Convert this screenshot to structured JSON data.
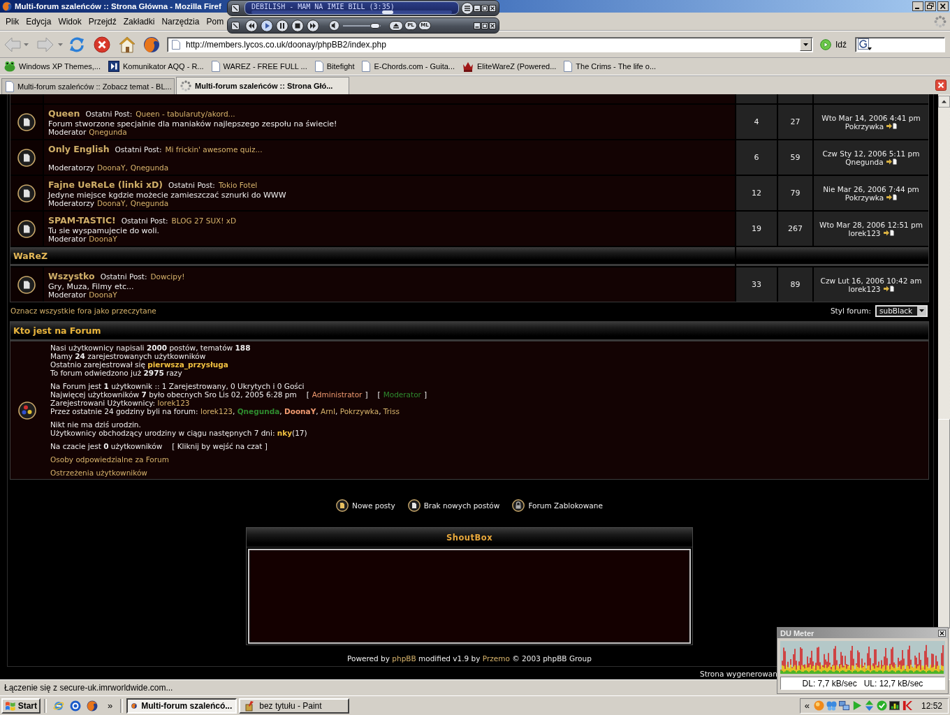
{
  "window": {
    "title": "Multi-forum szaleńców :: Strona Główna - Mozilla Firef"
  },
  "winamp": {
    "song": "DEBILISH - MAM NA IMIE BILL (3:35)",
    "seek": {
      "level": 0.68
    },
    "volume": {
      "level": 0.85
    },
    "buttons": [
      "PL",
      "ML"
    ]
  },
  "menu": [
    "Plik",
    "Edycja",
    "Widok",
    "Przejdź",
    "Zakładki",
    "Narzędzia",
    "Pom"
  ],
  "toolbar": {
    "back": {
      "disabled": true
    },
    "forward": {
      "disabled": true
    },
    "address": "http://members.lycos.co.uk/doonay/phpBB2/index.php",
    "go": "Idź"
  },
  "bookmarks": [
    {
      "label": "Windows XP Themes,...",
      "kind": "frog"
    },
    {
      "label": "Komunikator AQQ - R...",
      "kind": "player"
    },
    {
      "label": "WAREZ - FREE FULL ...",
      "kind": "page"
    },
    {
      "label": "Bitefight",
      "kind": "page"
    },
    {
      "label": "E-Chords.com - Guita...",
      "kind": "page"
    },
    {
      "label": "EliteWareZ (Powered...",
      "kind": "crown"
    },
    {
      "label": "The Crims - The life o...",
      "kind": "page"
    }
  ],
  "tabs": [
    {
      "label": "Multi-forum szaleńców :: Zobacz temat - BL...",
      "selected": false,
      "loading": false
    },
    {
      "label": "Multi-forum szaleńców :: Strona Głó...",
      "selected": true,
      "loading": true
    }
  ],
  "forum_table": {
    "rows": [
      {
        "kind": "forum",
        "name": "Queen",
        "last_label": "Ostatni Post:",
        "last_title": "Queen - tabularuty/akord...",
        "description": "Forum stworzone specjalnie dla maniaków najlepszego zespołu na świecie!",
        "mod_label": "Moderator",
        "moderators": [
          "Qnegunda"
        ],
        "topics": "4",
        "posts": "27",
        "last_date": "Wto Mar 14, 2006 4:41 pm",
        "last_author": "Pokrzywka"
      },
      {
        "kind": "forum",
        "name": "Only English",
        "last_label": "Ostatni Post:",
        "last_title": "Mi frickin' awesome quiz...",
        "mod_label": "Moderatorzy",
        "moderators": [
          "DoonaY,",
          "Qnegunda"
        ],
        "topics": "6",
        "posts": "59",
        "last_date": "Czw Sty 12, 2006 5:11 pm",
        "last_author": "Qnegunda"
      },
      {
        "kind": "forum",
        "name": "Fajne UeReLe (linki xD)",
        "last_label": "Ostatni Post:",
        "last_title": "Tokio Fotel",
        "description": "Jedyne miejsce kgdzie możecie zamieszczać sznurki do WWW",
        "mod_label": "Moderatorzy",
        "moderators": [
          "DoonaY,",
          "Qnegunda"
        ],
        "topics": "12",
        "posts": "79",
        "last_date": "Nie Mar 26, 2006 7:44 pm",
        "last_author": "Pokrzywka"
      },
      {
        "kind": "forum",
        "name": "SPAM-TASTIC!",
        "last_label": "Ostatni Post:",
        "last_title": "BLOG 27 SUX! xD",
        "description": "Tu sie wyspamujecie do woli.",
        "mod_label": "Moderator",
        "moderators": [
          "DoonaY"
        ],
        "topics": "19",
        "posts": "267",
        "last_date": "Wto Mar 28, 2006 12:51 pm",
        "last_author": "lorek123"
      },
      {
        "kind": "category",
        "name": "WaReZ"
      },
      {
        "kind": "forum",
        "name": "Wszystko",
        "last_label": "Ostatni Post:",
        "last_title": "Dowcipy!",
        "description": "Gry, Muza, Filmy etc...",
        "mod_label": "Moderator",
        "moderators": [
          "DoonaY"
        ],
        "topics": "33",
        "posts": "89",
        "last_date": "Czw Lut 16, 2006 10:42 am",
        "last_author": "lorek123"
      }
    ]
  },
  "mark_read": "Oznacz wszystkie fora jako przeczytane",
  "style_select": {
    "label": "Styl forum:",
    "value": "subBlack"
  },
  "who_online": {
    "title": "Kto jest na Forum",
    "blocks": [
      [
        [
          {
            "kind": "text",
            "text": "Nasi użytkownicy napisali **2000** postów, tematów **188**"
          }
        ],
        [
          {
            "kind": "text",
            "text": "Mamy **24** zarejestrowanych użytkowników"
          }
        ],
        [
          {
            "kind": "text",
            "text": "Ostatnio zarejestrował się "
          },
          {
            "kind": "highlight",
            "text": "pierwsza_przysługa"
          }
        ],
        [
          {
            "kind": "text",
            "text": "To forum odwiedzono już **2975** razy"
          }
        ]
      ],
      [
        [
          {
            "kind": "text",
            "text": "Na Forum jest **1** użytkownik :: 1 Zarejestrowany, 0 Ukrytych i 0 Gości"
          }
        ],
        [
          {
            "kind": "text",
            "text": "Najwięcej użytkowników **7** było obecnych Sro Lis 02, 2005 6:28 pm"
          },
          {
            "kind": "open",
            "text": "["
          },
          {
            "kind": "admin",
            "text": "Administrator"
          },
          {
            "kind": "close",
            "text": "]"
          },
          {
            "kind": "open",
            "text": "["
          },
          {
            "kind": "mod",
            "text": "Moderator"
          },
          {
            "kind": "close",
            "text": "]"
          }
        ],
        [
          {
            "kind": "text",
            "text": "Zarejestrowani Użytkownicy: "
          },
          {
            "kind": "link",
            "text": "lorek123"
          }
        ],
        [
          {
            "kind": "text",
            "text": "Przez ostatnie 24 godziny byli na forum: "
          },
          {
            "kind": "link",
            "text": "lorek123"
          },
          {
            "kind": "text",
            "text": ", "
          },
          {
            "kind": "mod",
            "text": "Qnegunda",
            "bold": true
          },
          {
            "kind": "text",
            "text": ", "
          },
          {
            "kind": "admin",
            "text": "DoonaY",
            "bold": true
          },
          {
            "kind": "text",
            "text": ", "
          },
          {
            "kind": "link",
            "text": "ArnI"
          },
          {
            "kind": "text",
            "text": ", "
          },
          {
            "kind": "link",
            "text": "Pokrzywka"
          },
          {
            "kind": "text",
            "text": ", "
          },
          {
            "kind": "link",
            "text": "Triss"
          }
        ]
      ],
      [
        [
          {
            "kind": "text",
            "text": "Nikt nie ma dziś urodzin."
          }
        ],
        [
          {
            "kind": "text",
            "text": "Użytkownicy obchodzący urodziny w ciągu następnych 7 dni: "
          },
          {
            "kind": "highlight",
            "text": "nky"
          },
          {
            "kind": "text",
            "text": "(17)"
          }
        ]
      ],
      [
        [
          {
            "kind": "text",
            "text": "Na czacie jest **0** użytkowników"
          },
          {
            "kind": "aside",
            "text": "[ Kliknij by wejść na czat ]"
          }
        ]
      ],
      [
        [
          {
            "kind": "link",
            "text": "Osoby odpowiedzialne za Forum"
          }
        ]
      ],
      [
        [
          {
            "kind": "link",
            "text": "Ostrzeżenia użytkowników"
          }
        ]
      ]
    ]
  },
  "legend": [
    {
      "label": "Nowe posty",
      "kind": "new"
    },
    {
      "label": "Brak nowych postów",
      "kind": "none"
    },
    {
      "label": "Forum Zablokowane",
      "kind": "locked"
    }
  ],
  "shoutbox": {
    "title": "ShoutBox"
  },
  "footer": [
    {
      "kind": "text",
      "text": "Powered by "
    },
    {
      "kind": "link",
      "text": "phpBB"
    },
    {
      "kind": "text",
      "text": " modified v1.9 by "
    },
    {
      "kind": "link",
      "text": "Przemo"
    },
    {
      "kind": "text",
      "text": " © 2003 phpBB Group"
    }
  ],
  "generated": "Strona wygenerowan",
  "status_bar": "Łączenie się z secure-uk.imrworldwide.com...",
  "taskbar": {
    "start": "Start",
    "more": "»",
    "tasks": [
      {
        "label": "Multi-forum szaleńcó...",
        "selected": true,
        "kind": "browser"
      },
      {
        "label": "bez tytułu - Paint",
        "selected": false,
        "kind": "paint"
      }
    ],
    "tray_expand": "«",
    "clock": "12:52"
  },
  "du_meter": {
    "title": "DU Meter",
    "download": "DL: 7,7 kB/sec",
    "upload": "UL: 12,7 kB/sec"
  }
}
